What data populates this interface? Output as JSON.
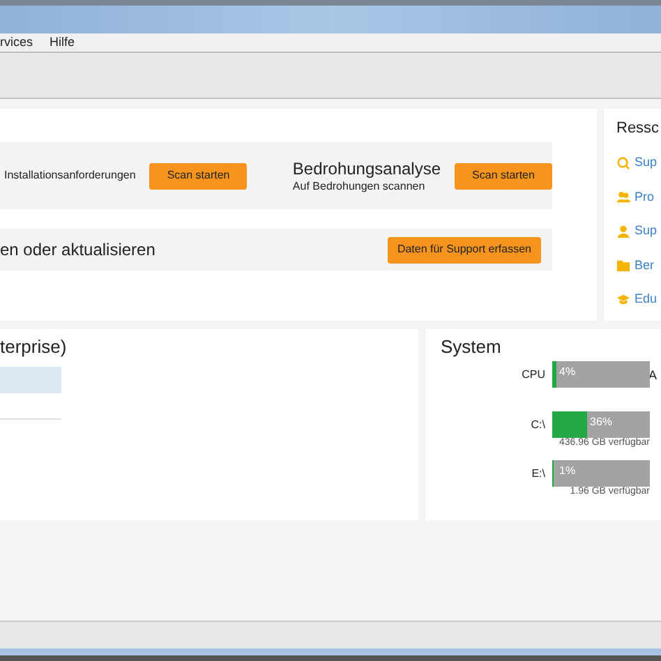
{
  "menu": [
    "rvices",
    "Hilfe"
  ],
  "tasks": {
    "row1": [
      {
        "text": "Installationsanforderungen",
        "button": "Scan starten"
      },
      {
        "title": "Bedrohungsanalyse",
        "text": "Auf Bedrohungen scannen",
        "button": "Scan starten"
      }
    ],
    "row2": {
      "text": "en oder aktualisieren",
      "button": "Daten für Support erfassen"
    }
  },
  "resources": {
    "title": "Ressc",
    "items": [
      {
        "kind": "search",
        "label": "Sup"
      },
      {
        "kind": "people",
        "label": "Pro"
      },
      {
        "kind": "person",
        "label": "Sup"
      },
      {
        "kind": "folder",
        "label": "Ber"
      },
      {
        "kind": "cap",
        "label": "Edu"
      }
    ]
  },
  "product": {
    "title": "terprise)",
    "rows": [
      {
        "selected": true
      },
      {
        "selected": false
      }
    ]
  },
  "system": {
    "title": "System",
    "meters": [
      {
        "label": "CPU",
        "level": 0.04,
        "reading": "4%"
      },
      {
        "label": "C:\\",
        "level": 0.36,
        "reading": "36%",
        "free": "436.96 GB verfügbar"
      },
      {
        "label": "E:\\",
        "level": 0.01,
        "reading": "1%",
        "free": "1.96 GB verfügbar"
      }
    ],
    "side_label": "A"
  }
}
